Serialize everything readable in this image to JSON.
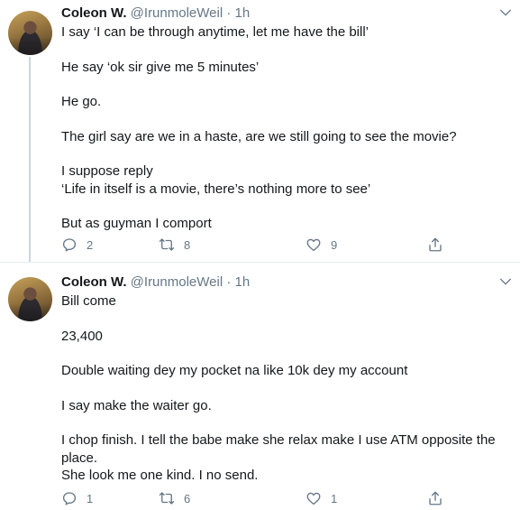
{
  "tweets": [
    {
      "name": "Coleon W.",
      "handle": "@IrunmoleWeil",
      "time": "1h",
      "lines": [
        "I say ‘I can be through anytime, let me have the bill’",
        "He say ‘ok sir give me 5 minutes’",
        "He go.",
        "The girl say are we in a haste, are we still going to see the movie?",
        "I suppose reply\n‘Life in itself is a movie, there’s nothing more to see’",
        "But as guyman I comport"
      ],
      "replies": "2",
      "retweets": "8",
      "likes": "9"
    },
    {
      "name": "Coleon W.",
      "handle": "@IrunmoleWeil",
      "time": "1h",
      "lines": [
        "Bill come",
        "23,400",
        "Double waiting dey my pocket na like 10k dey my account",
        "I say make the waiter go.",
        "I chop finish. I tell the babe make she relax make I use ATM opposite the place.\nShe look me one kind. I no send."
      ],
      "replies": "1",
      "retweets": "6",
      "likes": "1"
    }
  ],
  "separator": "·",
  "icons": {
    "reply": "reply-icon",
    "retweet": "retweet-icon",
    "like": "heart-icon",
    "share": "share-icon",
    "menu": "chevron-down-icon"
  },
  "colors": {
    "text": "#14171a",
    "muted": "#657786",
    "thread_line": "#ccd6dd",
    "divider": "#e6ecf0"
  }
}
